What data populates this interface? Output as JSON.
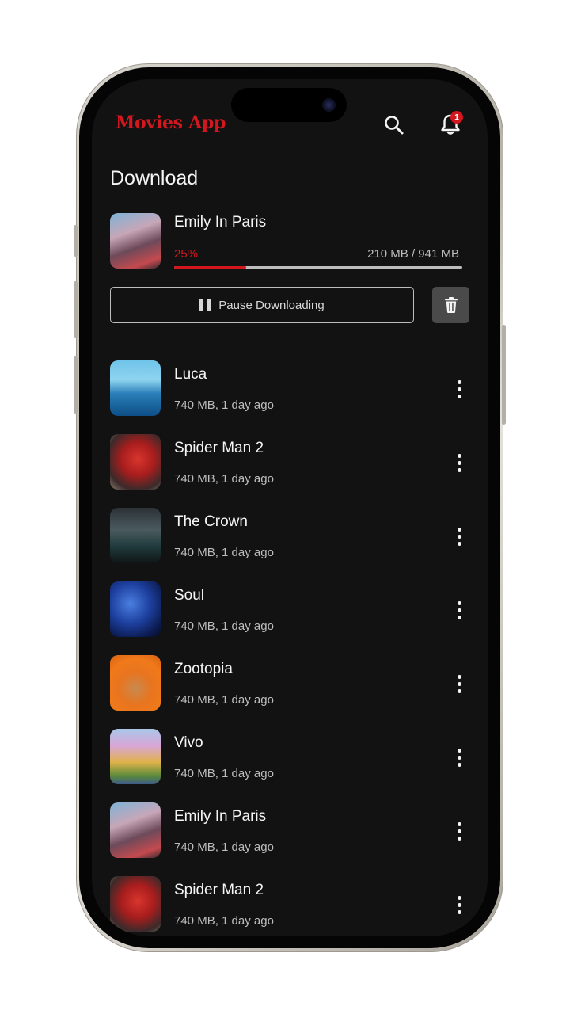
{
  "header": {
    "app_title": "Movies App",
    "notification_count": "1",
    "search_icon": "search-icon",
    "bell_icon": "bell-icon"
  },
  "download_section": {
    "title": "Download",
    "current": {
      "title": "Emily In Paris",
      "percent_label": "25%",
      "progress": 0.25,
      "size_label": "210 MB / 941 MB"
    },
    "pause_label": "Pause Downloading"
  },
  "downloads": [
    {
      "title": "Luca",
      "meta": "740 MB, 1 day ago"
    },
    {
      "title": "Spider Man 2",
      "meta": "740 MB, 1 day ago"
    },
    {
      "title": "The Crown",
      "meta": "740 MB, 1 day ago"
    },
    {
      "title": "Soul",
      "meta": "740 MB, 1 day ago"
    },
    {
      "title": "Zootopia",
      "meta": "740 MB, 1 day ago"
    },
    {
      "title": "Vivo",
      "meta": "740 MB, 1 day ago"
    },
    {
      "title": "Emily In Paris",
      "meta": "740 MB, 1 day ago"
    },
    {
      "title": "Spider Man 2",
      "meta": "740 MB, 1 day ago"
    }
  ],
  "colors": {
    "accent": "#d3171f",
    "background": "#121212",
    "text_primary": "#f5f5f5",
    "text_secondary": "#bdbdbd"
  }
}
